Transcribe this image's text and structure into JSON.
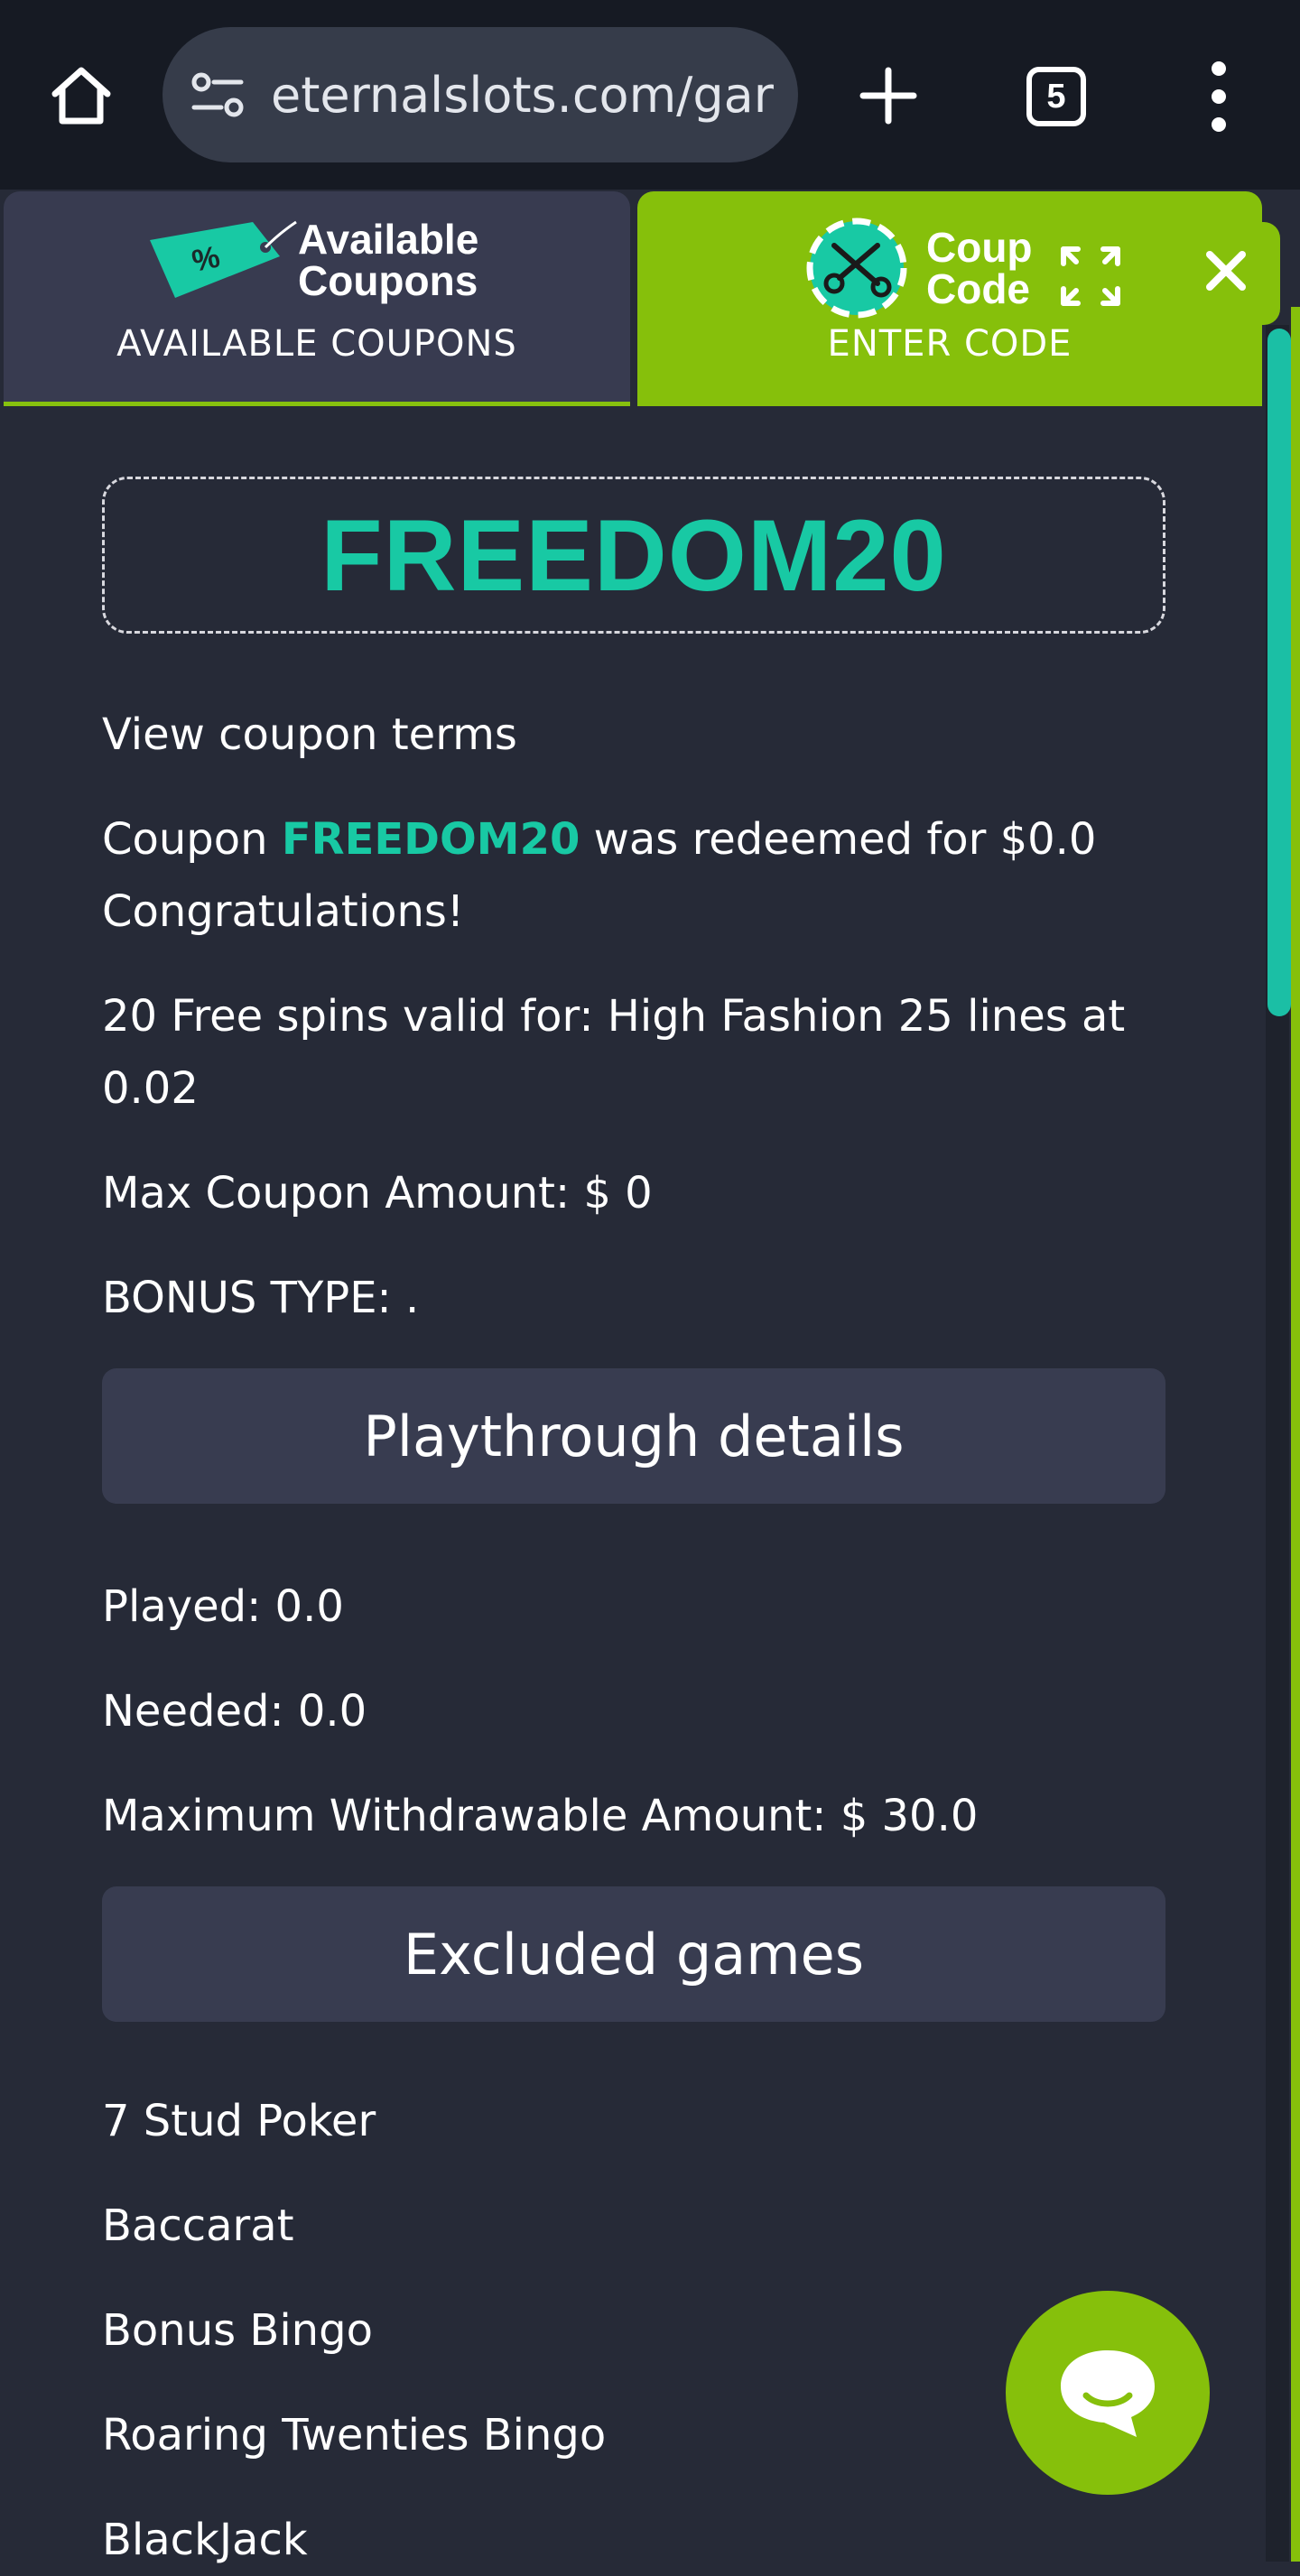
{
  "browser": {
    "url": "eternalslots.com/gar",
    "tab_count": "5"
  },
  "tabs": {
    "available": {
      "icon_title_line1": "Available",
      "icon_title_line2": "Coupons",
      "label": "AVAILABLE COUPONS"
    },
    "enter": {
      "icon_title_line1": "Coup",
      "icon_title_line2": "Code",
      "label": "ENTER CODE"
    }
  },
  "coupon": {
    "code": "FREEDOM20",
    "view_terms": "View coupon terms",
    "redeemed_prefix": "Coupon ",
    "redeemed_code": "FREEDOM20",
    "redeemed_suffix": " was redeemed for $0.0",
    "congrats": "Congratulations!",
    "free_spins_line1": "20 Free spins valid for: High Fashion 25 lines at",
    "free_spins_line2": "0.02",
    "max_amount": "Max Coupon Amount: $ 0",
    "bonus_type": "BONUS TYPE: ."
  },
  "playthrough": {
    "button_label": "Playthrough details",
    "played": "Played: 0.0",
    "needed": "Needed: 0.0",
    "max_withdrawable": "Maximum Withdrawable Amount: $ 30.0"
  },
  "excluded": {
    "button_label": "Excluded games",
    "games": [
      "7 Stud Poker",
      "Baccarat",
      "Bonus Bingo",
      "Roaring Twenties Bingo",
      "BlackJack"
    ]
  },
  "colors": {
    "accent_teal": "#18c9a4",
    "accent_green": "#86c00b",
    "background": "#262a37",
    "panel": "#383c50"
  }
}
